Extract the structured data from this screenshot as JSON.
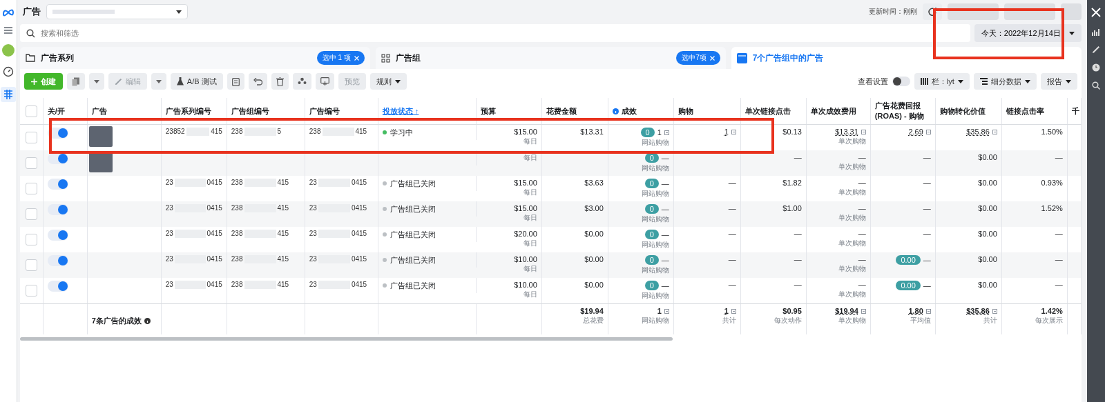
{
  "header": {
    "title": "广告",
    "updated": "更新时间：刚刚"
  },
  "search": {
    "placeholder": "搜索和筛选"
  },
  "date_range": "今天：2022年12月14日",
  "tabs": [
    {
      "label": "广告系列",
      "badge": "选中 1 项",
      "selected": false,
      "kind": "folder"
    },
    {
      "label": "广告组",
      "badge": "选中7项",
      "selected": false,
      "kind": "grid"
    },
    {
      "label": "7个广告组中的广告",
      "selected": true,
      "kind": "ad"
    }
  ],
  "toolbar": {
    "create": "创建",
    "edit": "编辑",
    "ab_test": "A/B 测试",
    "preview": "预览",
    "rules": "规则",
    "view_settings": "查看设置",
    "view_settings_on": false,
    "columns": "栏：lyt",
    "breakdown": "细分数据",
    "reports": "报告"
  },
  "table": {
    "select_all_checked": false,
    "columns": [
      {
        "label": "关/开",
        "sorted": false
      },
      {
        "label": "广告",
        "sorted": false
      },
      {
        "label": "广告系列编号",
        "sorted": false
      },
      {
        "label": "广告组编号",
        "sorted": false
      },
      {
        "label": "广告编号",
        "sorted": false
      },
      {
        "label": "投放状态 ↑",
        "sorted": true
      },
      {
        "label": "预算",
        "sorted": false
      },
      {
        "label": "花费金额",
        "sorted": false
      },
      {
        "label": "成效",
        "sorted": false,
        "info": true
      },
      {
        "label": "购物",
        "sorted": false
      },
      {
        "label": "单次链接点击",
        "sorted": false
      },
      {
        "label": "单次成效费用",
        "sorted": false
      },
      {
        "label": "广告花费回报 (ROAS) - 购物",
        "sorted": false
      },
      {
        "label": "购物转化价值",
        "sorted": false
      },
      {
        "label": "链接点击率",
        "sorted": false
      },
      {
        "label": "千",
        "sorted": false
      }
    ],
    "rows": [
      {
        "selected": false,
        "on": true,
        "thumbnail": true,
        "ids": [
          [
            "23852",
            "415"
          ],
          [
            "238",
            "5"
          ],
          [
            "238",
            "415"
          ]
        ],
        "status": {
          "label": "学习中",
          "color": "#45bd62"
        },
        "budget": {
          "value": "$15.00",
          "sub": "每日"
        },
        "spend": {
          "value": "$13.31"
        },
        "result": {
          "badge": "0",
          "value": "1",
          "sub": "网站购物",
          "note_icon": true
        },
        "purchase": {
          "value": "1",
          "underlined": true,
          "note_icon": true
        },
        "link_cost": {
          "value": "$0.13"
        },
        "cost_per": {
          "value": "$13.31",
          "sub": "单次购物",
          "underlined": true,
          "note_icon": true
        },
        "roas": {
          "value": "2.69",
          "underlined": true,
          "note_icon": true
        },
        "conv_value": {
          "value": "$35.86",
          "underlined": true,
          "note_icon": true
        },
        "ctr": {
          "value": "1.50%"
        }
      },
      {
        "selected": false,
        "on": true,
        "thumbnail": true,
        "ids": [],
        "budget": {
          "sub": "每日"
        },
        "spend": {},
        "result": {
          "badge": "0",
          "value": "—",
          "sub": "网站购物"
        },
        "purchase": {},
        "link_cost": {
          "value": "—"
        },
        "cost_per": {
          "value": "—",
          "sub": "单次购物"
        },
        "roas": {
          "value": "—"
        },
        "conv_value": {
          "value": "$0.00"
        },
        "ctr": {
          "value": "—"
        }
      },
      {
        "selected": false,
        "on": true,
        "thumbnail": false,
        "ids": [
          [
            "23",
            "0415"
          ],
          [
            "238",
            "415"
          ],
          [
            "23",
            "0415"
          ]
        ],
        "status": {
          "label": "广告组已关闭",
          "color": "#bcc0c4"
        },
        "budget": {
          "value": "$15.00",
          "sub": "每日"
        },
        "spend": {
          "value": "$3.63"
        },
        "result": {
          "badge": "0",
          "value": "—",
          "sub": "网站购物"
        },
        "purchase": {
          "value": "—"
        },
        "link_cost": {
          "value": "$1.82"
        },
        "cost_per": {
          "value": "—",
          "sub": "单次购物"
        },
        "roas": {
          "value": "—"
        },
        "conv_value": {
          "value": "$0.00"
        },
        "ctr": {
          "value": "0.93%"
        }
      },
      {
        "selected": false,
        "on": true,
        "thumbnail": false,
        "ids": [
          [
            "23",
            "0415"
          ],
          [
            "238",
            "415"
          ],
          [
            "23",
            "0415"
          ]
        ],
        "status": {
          "label": "广告组已关闭",
          "color": "#bcc0c4"
        },
        "budget": {
          "value": "$15.00",
          "sub": "每日"
        },
        "spend": {
          "value": "$3.00"
        },
        "result": {
          "badge": "0",
          "value": "—",
          "sub": "网站购物"
        },
        "purchase": {
          "value": "—"
        },
        "link_cost": {
          "value": "$1.00"
        },
        "cost_per": {
          "value": "—",
          "sub": "单次购物"
        },
        "roas": {
          "value": "—"
        },
        "conv_value": {
          "value": "$0.00"
        },
        "ctr": {
          "value": "1.52%"
        }
      },
      {
        "selected": false,
        "on": true,
        "thumbnail": false,
        "ids": [
          [
            "23",
            "0415"
          ],
          [
            "238",
            "415"
          ],
          [
            "23",
            "0415"
          ]
        ],
        "status": {
          "label": "广告组已关闭",
          "color": "#bcc0c4"
        },
        "budget": {
          "value": "$20.00",
          "sub": "每日"
        },
        "spend": {
          "value": "$0.00"
        },
        "result": {
          "badge": "0",
          "value": "—",
          "sub": "网站购物"
        },
        "purchase": {
          "value": "—"
        },
        "link_cost": {
          "value": "—"
        },
        "cost_per": {
          "value": "—",
          "sub": "单次购物"
        },
        "roas": {
          "value": "—"
        },
        "conv_value": {
          "value": "$0.00"
        },
        "ctr": {
          "value": "—"
        }
      },
      {
        "selected": false,
        "on": true,
        "thumbnail": false,
        "ids": [
          [
            "23",
            "0415"
          ],
          [
            "238",
            "415"
          ],
          [
            "23",
            "0415"
          ]
        ],
        "status": {
          "label": "广告组已关闭",
          "color": "#bcc0c4"
        },
        "budget": {
          "value": "$10.00",
          "sub": "每日"
        },
        "spend": {
          "value": "$0.00"
        },
        "result": {
          "badge": "0",
          "value": "—",
          "sub": "网站购物"
        },
        "purchase": {
          "value": "—"
        },
        "link_cost": {
          "value": "—"
        },
        "cost_per": {
          "value": "—",
          "sub": "单次购物"
        },
        "roas": {
          "badge": "0.00",
          "value": "—"
        },
        "conv_value": {
          "value": "$0.00"
        },
        "ctr": {
          "value": "—"
        }
      },
      {
        "selected": false,
        "on": true,
        "thumbnail": false,
        "ids": [
          [
            "23",
            "0415"
          ],
          [
            "238",
            "415"
          ],
          [
            "23",
            "0415"
          ]
        ],
        "status": {
          "label": "广告组已关闭",
          "color": "#bcc0c4"
        },
        "budget": {
          "value": "$10.00",
          "sub": "每日"
        },
        "spend": {
          "value": "$0.00"
        },
        "result": {
          "badge": "0",
          "value": "—",
          "sub": "网站购物"
        },
        "purchase": {
          "value": "—"
        },
        "link_cost": {
          "value": "—"
        },
        "cost_per": {
          "value": "—",
          "sub": "单次购物"
        },
        "roas": {
          "badge": "0.00",
          "value": "—"
        },
        "conv_value": {
          "value": "$0.00"
        },
        "ctr": {
          "value": "—"
        }
      }
    ],
    "footer": {
      "label": "7条广告的成效",
      "spend": {
        "value": "$19.94",
        "sub": "总花费"
      },
      "result": {
        "value": "1",
        "sub": "网站购物",
        "note_icon": true
      },
      "purchase": {
        "value": "1",
        "sub": "共计",
        "underlined": true,
        "note_icon": true
      },
      "link_cost": {
        "value": "$0.95",
        "sub": "每次动作"
      },
      "cost_per": {
        "value": "$19.94",
        "sub": "单次购物",
        "underlined": true,
        "note_icon": true
      },
      "roas": {
        "value": "1.80",
        "sub": "平均值",
        "underlined": true,
        "note_icon": true
      },
      "conv_value": {
        "value": "$35.86",
        "sub": "共计",
        "underlined": true,
        "note_icon": true
      },
      "ctr": {
        "value": "1.42%",
        "sub": "每次展示"
      }
    }
  }
}
